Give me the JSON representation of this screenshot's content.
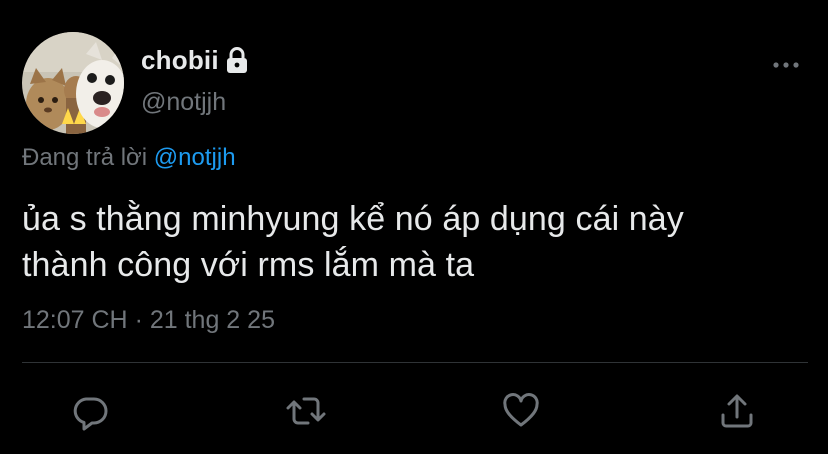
{
  "user": {
    "display_name": "chobii",
    "handle": "@notjjh",
    "avatar_icon": "avatar-cats-dog-photo",
    "locked_icon": "lock-icon"
  },
  "reply": {
    "prefix": "Đang trả lời",
    "mention": "@notjjh"
  },
  "tweet": {
    "text_line1": "ủa s thằng minhyung kể nó áp dụng cái này",
    "text_line2": "thành công với rms lắm mà ta",
    "time": "12:07 CH",
    "separator": "·",
    "date": "21 thg 2 25"
  },
  "actions": [
    {
      "icon": "reply-icon"
    },
    {
      "icon": "retweet-icon"
    },
    {
      "icon": "like-icon"
    },
    {
      "icon": "share-icon"
    }
  ],
  "menu": {
    "icon": "more-options-icon"
  },
  "colors": {
    "background": "#000000",
    "text": "#e7e9ea",
    "secondary": "#71767b",
    "link": "#1d9bf0",
    "divider": "#2f3336"
  }
}
